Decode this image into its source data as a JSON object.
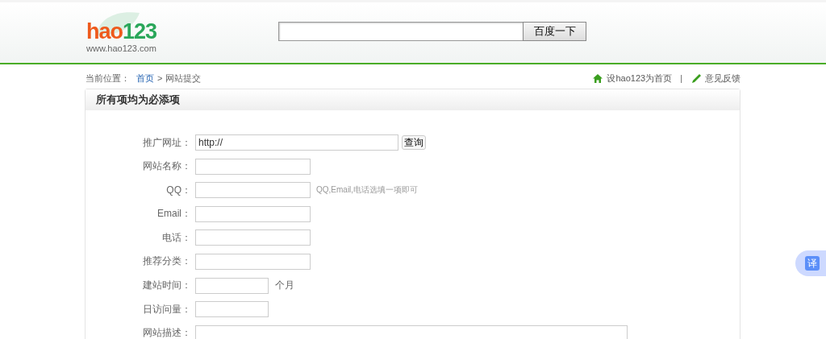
{
  "logo": {
    "brand_first": "hao",
    "brand_second": "123",
    "url": "www.hao123.com"
  },
  "search": {
    "button": "百度一下"
  },
  "breadcrumb": {
    "label": "当前位置：",
    "items": [
      {
        "text": "首页",
        "kind": "link"
      },
      {
        "text": "网站提交",
        "kind": "current"
      }
    ],
    "separator": ">"
  },
  "top_links_divider": "|",
  "top_links": [
    {
      "text": "设hao123为首页",
      "kind": "home"
    },
    {
      "text": "意见反馈",
      "kind": "pencil"
    }
  ],
  "panel": {
    "title": "所有项均为必添项"
  },
  "form": [
    {
      "label": "推广网址：",
      "kind": "long",
      "value": "http://",
      "button": "查询"
    },
    {
      "label": "网站名称：",
      "kind": "normal"
    },
    {
      "label": "QQ：",
      "kind": "normal",
      "note": "QQ,Email,电话选填一项即可"
    },
    {
      "label": "Email：",
      "kind": "normal"
    },
    {
      "label": "电话：",
      "kind": "normal"
    },
    {
      "label": "推荐分类：",
      "kind": "normal"
    },
    {
      "label": "建站时间：",
      "kind": "short",
      "suffix": "个月"
    },
    {
      "label": "日访问量：",
      "kind": "short"
    },
    {
      "label": "网站描述：",
      "kind": "area"
    }
  ],
  "translate_button": {
    "text": "译"
  }
}
